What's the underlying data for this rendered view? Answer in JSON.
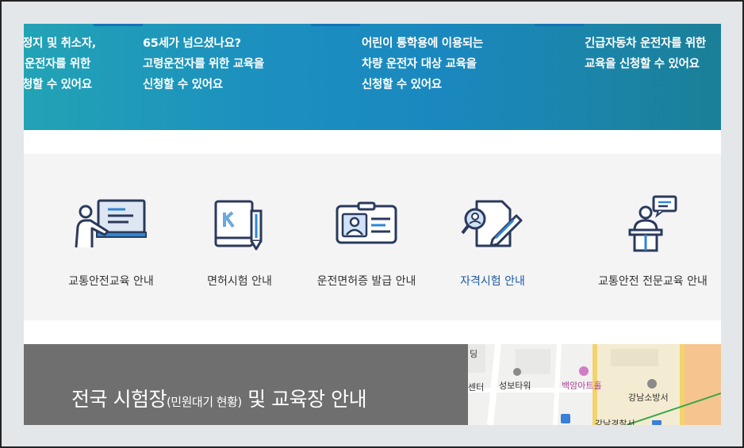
{
  "banner": {
    "items": [
      {
        "lines": [
          "정지 및 취소자,",
          "운전자를 위한",
          "청할 수 있어요"
        ]
      },
      {
        "lines": [
          "65세가 넘으셨나요?",
          "고령운전자를 위한 교육을",
          "신청할 수 있어요"
        ]
      },
      {
        "lines": [
          "어린이 통학용에 이용되는",
          "차량 운전자 대상 교육을",
          "신청할 수 있어요"
        ]
      },
      {
        "lines": [
          "긴급자동차 운전자를 위한",
          "교육을 신청할 수 있어요"
        ]
      }
    ]
  },
  "guide": {
    "items": [
      {
        "label": "교통안전교육 안내",
        "icon": "teacher-board-icon"
      },
      {
        "label": "면허시험 안내",
        "icon": "license-book-pen-icon"
      },
      {
        "label": "운전면허증 발급 안내",
        "icon": "id-card-icon"
      },
      {
        "label": "자격시험 안내",
        "icon": "document-search-pen-icon",
        "active": true
      },
      {
        "label": "교통안전 전문교육 안내",
        "icon": "lecturer-podium-icon"
      }
    ]
  },
  "exam": {
    "title_main": "전국 시험장",
    "title_sub": "(민원대기 현황)",
    "title_tail": " 및 교육장 안내"
  },
  "map": {
    "labels": [
      "딩",
      "센터",
      "성보타워",
      "백암아트홀",
      "강남소방서",
      "강남경찰서"
    ]
  },
  "colors": {
    "banner_start": "#22a3b5",
    "banner_end": "#1a7f98",
    "icon_navy": "#2b3a5c",
    "icon_blue": "#2f86d6",
    "active_label": "#1d5aa5",
    "exam_bg": "#6f6f6f"
  }
}
